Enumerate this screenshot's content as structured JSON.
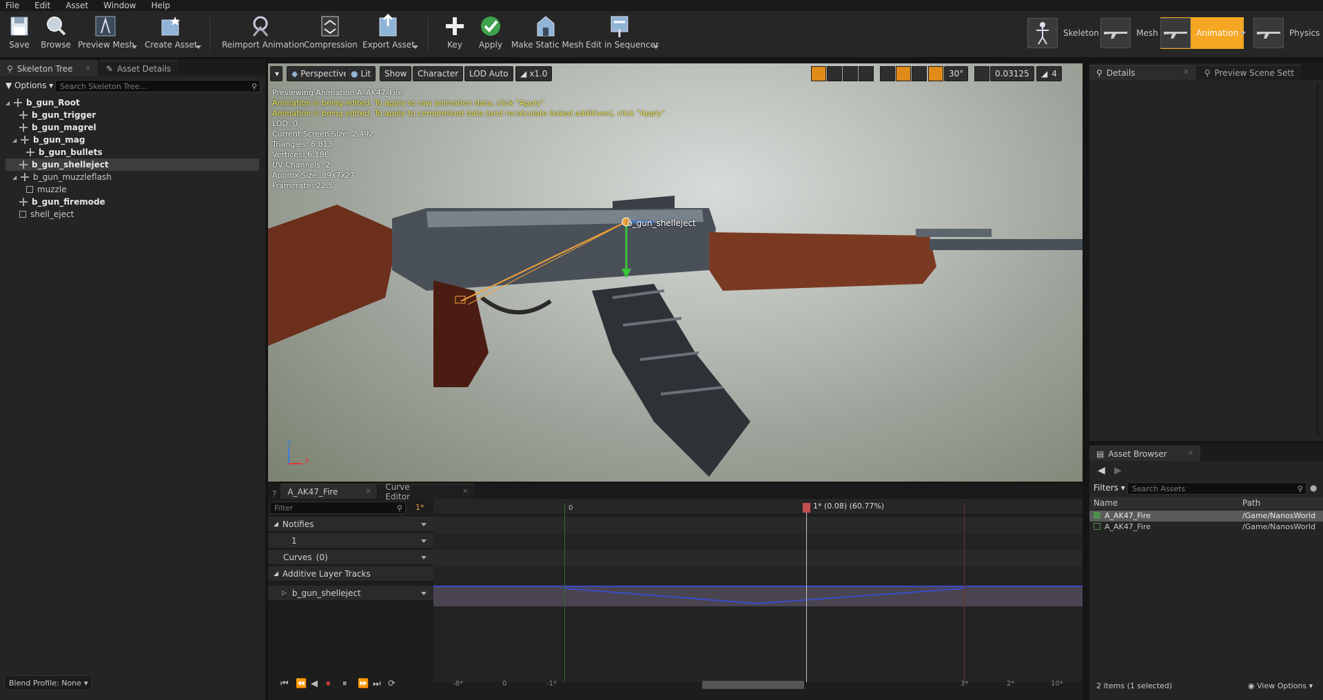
{
  "menu": [
    "File",
    "Edit",
    "Asset",
    "Window",
    "Help"
  ],
  "toolbar": {
    "buttons": [
      "Save",
      "Browse",
      "Preview Mesh",
      "Create Asset",
      "Reimport Animation",
      "Compression",
      "Export Asset",
      "Key",
      "Apply",
      "Make Static Mesh",
      "Edit in Sequencer"
    ],
    "modes": [
      "Skeleton",
      "Mesh",
      "Animation",
      "Physics"
    ],
    "active_mode_color": "#f5a623"
  },
  "left": {
    "tabs": [
      "Skeleton Tree",
      "Asset Details"
    ],
    "options_label": "Options",
    "search_placeholder": "Search Skeleton Tree...",
    "items": [
      {
        "label": "b_gun_Root",
        "bold": true,
        "icon": "bone-icon"
      },
      {
        "label": "b_gun_trigger",
        "bold": true,
        "icon": "bone-icon"
      },
      {
        "label": "b_gun_magrel",
        "bold": true,
        "icon": "bone-icon"
      },
      {
        "label": "b_gun_mag",
        "bold": true,
        "icon": "bone-icon"
      },
      {
        "label": "b_gun_bullets",
        "bold": true,
        "icon": "bone-icon"
      },
      {
        "label": "b_gun_shelleject",
        "bold": true,
        "icon": "bone-icon"
      },
      {
        "label": "b_gun_muzzleflash",
        "bold": false,
        "icon": "bone-icon"
      },
      {
        "label": "muzzle",
        "bold": false,
        "icon": "socket-icon"
      },
      {
        "label": "b_gun_firemode",
        "bold": true,
        "icon": "bone-icon"
      },
      {
        "label": "shell_eject",
        "bold": false,
        "icon": "socket-icon"
      }
    ],
    "blend_profile": "Blend Profile: None"
  },
  "viewport": {
    "buttons": [
      "Perspective",
      "Lit",
      "Show",
      "Character",
      "LOD Auto",
      "x1.0"
    ],
    "snap_angle": "30°",
    "snap_scale": "0.03125",
    "camera_speed": "4",
    "info": [
      "Previewing Animation A_AK47_Fire",
      "Animation is being edited. To apply to raw animation data, click \"Apply\"",
      "Animation is being edited. To apply to compressed data (and recalculate baked additives), click \"Apply\"",
      "LOD: 0",
      "Current Screen Size: 2.492",
      "Triangles: 6,813",
      "Vertices: 6,186",
      "UV Channels: 2",
      "Approx Size: 89x7x27",
      "Framerate: 22.5"
    ],
    "bone_label": "b_gun_shelleject",
    "axis_z": "Z",
    "axis_x": "X"
  },
  "right": {
    "tabs": [
      "Details",
      "Preview Scene Sett"
    ]
  },
  "asset_browser": {
    "tab": "Asset Browser",
    "filters_label": "Filters",
    "search_placeholder": "Search Assets",
    "col_name": "Name",
    "col_path": "Path",
    "rows": [
      {
        "name": "A_AK47_Fire",
        "path": "/Game/NanosWorld"
      },
      {
        "name": "A_AK47_Fire",
        "path": "/Game/NanosWorld"
      }
    ],
    "status": "2 items (1 selected)",
    "view_options": "View Options"
  },
  "timeline": {
    "tabs": [
      "A_AK47_Fire",
      "Curve Editor"
    ],
    "filter_placeholder": "Filter",
    "marker_top": "1*",
    "start_frame": "0",
    "scrubber": "1* (0.08) (60.77%)",
    "tracks": {
      "notifies": "Notifies",
      "notify_row": "1",
      "curves": "Curves",
      "curves_count": "(0)",
      "additive": "Additive Layer Tracks",
      "bone": "b_gun_shelleject"
    },
    "bottom_ticks": [
      "-8*",
      "0",
      "-1*",
      "3*",
      "2*",
      "10*"
    ]
  }
}
